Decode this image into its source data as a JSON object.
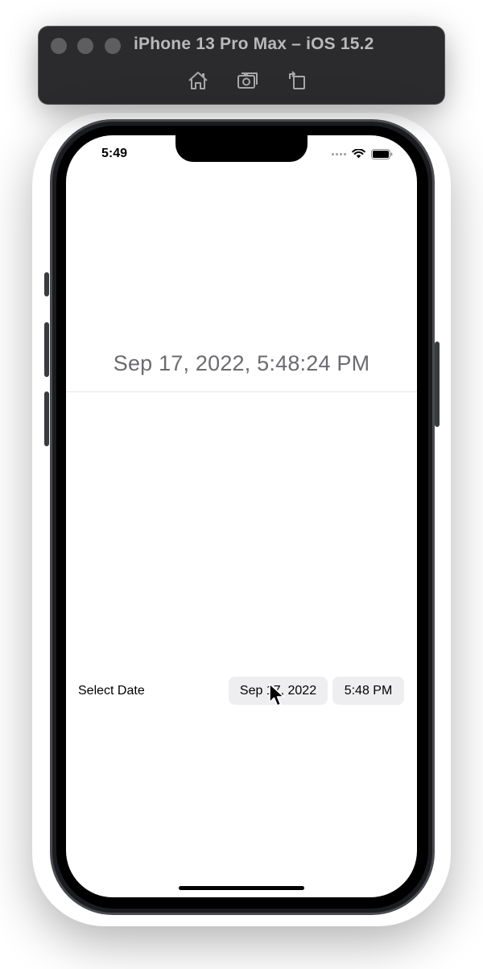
{
  "simulator": {
    "title": "iPhone 13 Pro Max – iOS 15.2",
    "toolbar_icons": [
      "home-icon",
      "screenshot-icon",
      "rotate-icon"
    ]
  },
  "status_bar": {
    "time": "5:49",
    "icons": [
      "cellular-dots-icon",
      "wifi-icon",
      "battery-icon"
    ]
  },
  "content": {
    "selected_datetime": "Sep 17, 2022, 5:48:24 PM",
    "picker": {
      "label": "Select Date",
      "date_value": "Sep 17, 2022",
      "time_value": "5:48 PM"
    }
  },
  "colors": {
    "datetime_text": "#6b6b70",
    "pill_background": "#eeeef0",
    "toolbar_background": "#2b2b2d"
  }
}
